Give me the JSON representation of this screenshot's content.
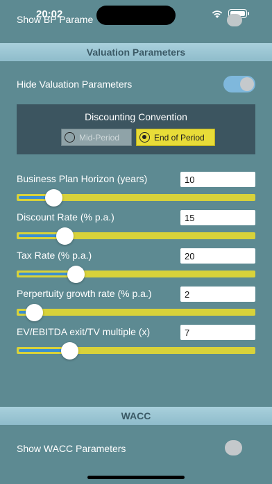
{
  "status": {
    "time": "20:02"
  },
  "top_row": {
    "label": "Show BP Parame",
    "toggle_on": false
  },
  "valuation": {
    "header": "Valuation Parameters",
    "hide_label": "Hide Valuation Parameters",
    "hide_on": true,
    "discounting": {
      "title": "Discounting Convention",
      "options": [
        "Mid-Period",
        "End of Period"
      ],
      "selected": "End of Period"
    },
    "params": [
      {
        "label": "Business Plan Horizon (years)",
        "value": "10",
        "slider_fraction": 0.13
      },
      {
        "label": "Discount Rate (% p.a.)",
        "value": "15",
        "slider_fraction": 0.18
      },
      {
        "label": "Tax Rate (% p.a.)",
        "value": "20",
        "slider_fraction": 0.23
      },
      {
        "label": "Perpertuity growth rate (% p.a.)",
        "value": "2",
        "slider_fraction": 0.04
      },
      {
        "label": "EV/EBITDA exit/TV multiple (x)",
        "value": "7",
        "slider_fraction": 0.2
      }
    ]
  },
  "wacc": {
    "header": "WACC",
    "show_label": "Show WACC Parameters",
    "show_on": false
  },
  "colors": {
    "background": "#5d8a92",
    "slider_track": "#d8d23a",
    "slider_fill": "#3b8fd0",
    "selected_segment": "#e8dc38",
    "toggle_on": "#7fb8dc"
  },
  "icons": [
    "wifi-icon",
    "battery-icon"
  ]
}
